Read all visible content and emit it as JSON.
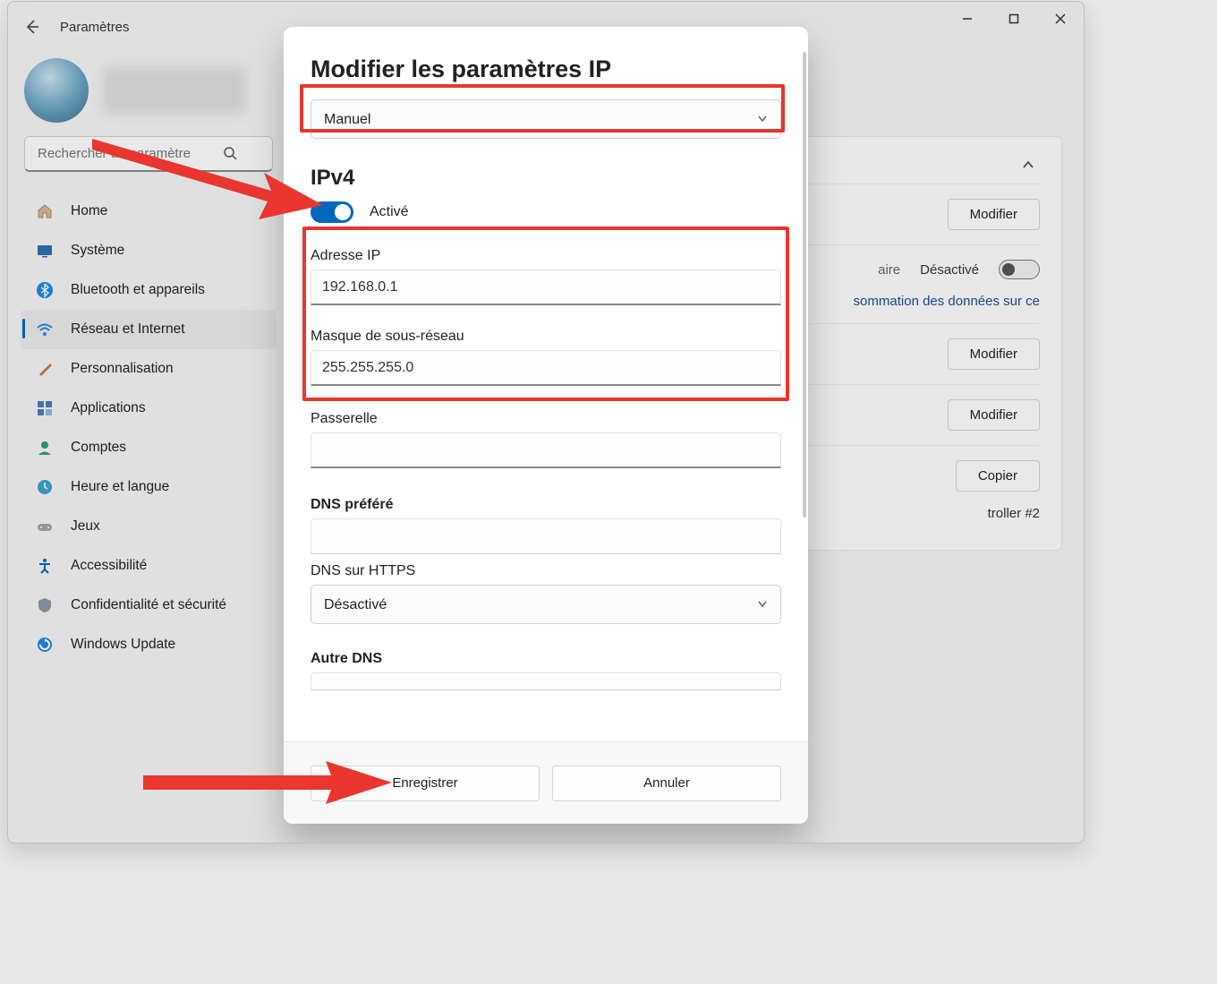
{
  "appTitle": "Paramètres",
  "search": {
    "placeholder": "Rechercher un paramètre"
  },
  "nav": {
    "items": [
      {
        "label": "Home"
      },
      {
        "label": "Système"
      },
      {
        "label": "Bluetooth et appareils"
      },
      {
        "label": "Réseau et Internet"
      },
      {
        "label": "Personnalisation"
      },
      {
        "label": "Applications"
      },
      {
        "label": "Comptes"
      },
      {
        "label": "Heure et langue"
      },
      {
        "label": "Jeux"
      },
      {
        "label": "Accessibilité"
      },
      {
        "label": "Confidentialité et sécurité"
      },
      {
        "label": "Windows Update"
      }
    ]
  },
  "main": {
    "modifier": "Modifier",
    "copier": "Copier",
    "deact": "Désactivé",
    "row2tail": "aire",
    "linktail": "sommation des données sur ce",
    "desc": "troller #2"
  },
  "modal": {
    "title": "Modifier les paramètres IP",
    "mode": "Manuel",
    "ipv4Title": "IPv4",
    "ipv4Toggle": "Activé",
    "ipLabel": "Adresse IP",
    "ipValue": "192.168.0.1",
    "maskLabel": "Masque de sous-réseau",
    "maskValue": "255.255.255.0",
    "gatewayLabel": "Passerelle",
    "gatewayValue": "",
    "dns1Label": "DNS préféré",
    "dns1Value": "",
    "dohLabel": "DNS sur HTTPS",
    "dohValue": "Désactivé",
    "dns2Label": "Autre DNS",
    "saveLabel": "Enregistrer",
    "cancelLabel": "Annuler"
  }
}
